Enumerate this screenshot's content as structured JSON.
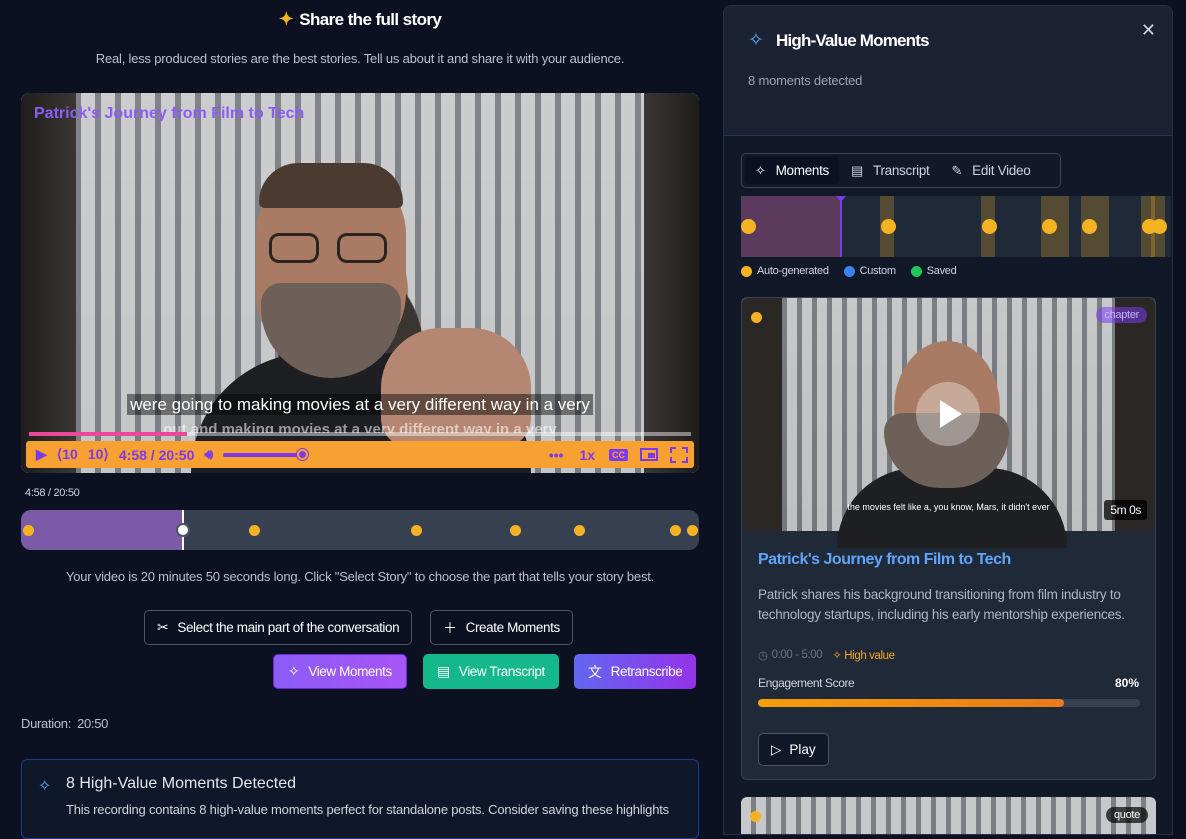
{
  "header": {
    "title": "Share the full story",
    "subtitle": "Real, less produced stories are the best stories. Tell us about it and share it with your audience."
  },
  "player": {
    "title": "Patrick's Journey from Film to Tech",
    "caption_main": "were going to making movies at a very different way in a very",
    "caption_secondary": "out and making movies at a very different way in a very",
    "skip_back": "10",
    "skip_forward": "10",
    "time_display": "4:58 / 20:50",
    "speed": "1x",
    "cc": "CC",
    "progress_fraction": 0.239,
    "volume_fraction": 1.0,
    "accent_color": "#f7a133",
    "icon_color": "#7c3aed"
  },
  "timeline": {
    "time_label": "4:58 / 20:50",
    "played_fraction": 0.239,
    "markers_fraction": [
      0.01,
      0.344,
      0.583,
      0.728,
      0.823,
      0.965,
      0.99
    ]
  },
  "hint": "Your video is 20 minutes 50 seconds long. Click \"Select Story\" to choose the part that tells your story best.",
  "actions": {
    "select_main": "Select the main part of the conversation",
    "create_moments": "Create Moments",
    "view_moments": "View Moments",
    "view_transcript": "View Transcript",
    "retranscribe": "Retranscribe"
  },
  "duration": {
    "label": "Duration:",
    "value": "20:50"
  },
  "banner": {
    "title": "8 High-Value Moments Detected",
    "text": "This recording contains 8 high-value moments perfect for standalone posts. Consider saving these highlights"
  },
  "panel": {
    "title": "High-Value Moments",
    "count": "8 moments detected",
    "close_icon": "close-icon",
    "tabs": [
      {
        "label": "Moments",
        "icon": "sparkles-icon",
        "active": true
      },
      {
        "label": "Transcript",
        "icon": "document-icon",
        "active": false
      },
      {
        "label": "Edit Video",
        "icon": "edit-icon",
        "active": false
      }
    ],
    "mini_timeline": {
      "playhead_fraction": 0.23,
      "markers_fraction": [
        0.017,
        0.343,
        0.577,
        0.716,
        0.809,
        0.949,
        0.972
      ]
    },
    "legend": [
      {
        "label": "Auto-generated",
        "color": "#f5b324"
      },
      {
        "label": "Custom",
        "color": "#3b82f6"
      },
      {
        "label": "Saved",
        "color": "#22c55e"
      }
    ],
    "cards": [
      {
        "chip": "chapter",
        "duration": "5m 0s",
        "thumb_caption": "the movies felt like a, you know, Mars, it didn't ever",
        "title": "Patrick's Journey from Film to Tech",
        "description": "Patrick shares his background transitioning from film industry to technology startups, including his early mentorship experiences.",
        "time_range": "0:00 - 5:00",
        "value_label": "High value",
        "engagement_label": "Engagement Score",
        "engagement_value": "80%",
        "engagement_fraction": 0.8,
        "play_label": "Play"
      },
      {
        "chip": "quote"
      }
    ]
  }
}
